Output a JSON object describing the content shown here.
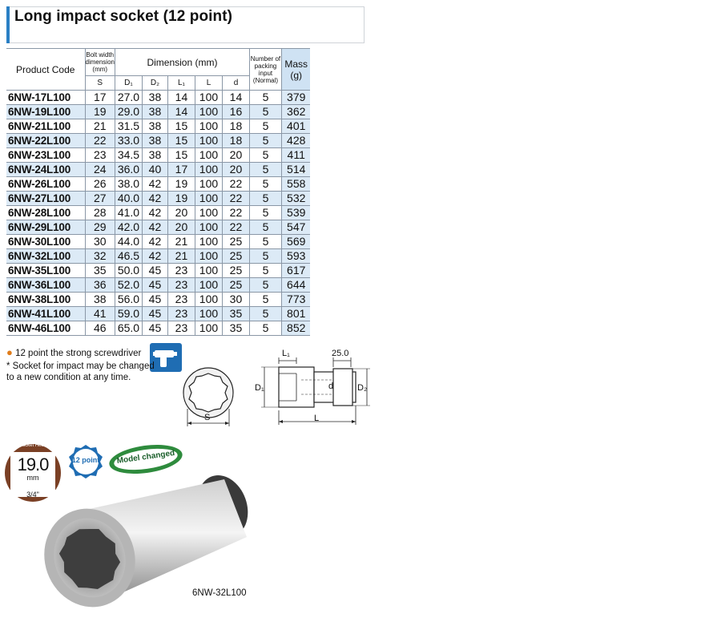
{
  "title": "Long impact socket (12 point)",
  "table": {
    "headers": {
      "product_code": "Product Code",
      "bolt_width": "Bolt width dimension (mm)",
      "dimension": "Dimension (mm)",
      "packing": "Number of packing input (Normal)",
      "mass": "Mass (g)"
    },
    "subheaders": [
      "S",
      "D₁",
      "D₂",
      "L₁",
      "L",
      "d"
    ],
    "rows": [
      {
        "code": "6NW-17L100",
        "s": "17",
        "d1": "27.0",
        "d2": "38",
        "l1": "14",
        "l": "100",
        "d": "14",
        "pack": "5",
        "mass": "379"
      },
      {
        "code": "6NW-19L100",
        "s": "19",
        "d1": "29.0",
        "d2": "38",
        "l1": "14",
        "l": "100",
        "d": "16",
        "pack": "5",
        "mass": "362"
      },
      {
        "code": "6NW-21L100",
        "s": "21",
        "d1": "31.5",
        "d2": "38",
        "l1": "15",
        "l": "100",
        "d": "18",
        "pack": "5",
        "mass": "401"
      },
      {
        "code": "6NW-22L100",
        "s": "22",
        "d1": "33.0",
        "d2": "38",
        "l1": "15",
        "l": "100",
        "d": "18",
        "pack": "5",
        "mass": "428"
      },
      {
        "code": "6NW-23L100",
        "s": "23",
        "d1": "34.5",
        "d2": "38",
        "l1": "15",
        "l": "100",
        "d": "20",
        "pack": "5",
        "mass": "411"
      },
      {
        "code": "6NW-24L100",
        "s": "24",
        "d1": "36.0",
        "d2": "40",
        "l1": "17",
        "l": "100",
        "d": "20",
        "pack": "5",
        "mass": "514"
      },
      {
        "code": "6NW-26L100",
        "s": "26",
        "d1": "38.0",
        "d2": "42",
        "l1": "19",
        "l": "100",
        "d": "22",
        "pack": "5",
        "mass": "558"
      },
      {
        "code": "6NW-27L100",
        "s": "27",
        "d1": "40.0",
        "d2": "42",
        "l1": "19",
        "l": "100",
        "d": "22",
        "pack": "5",
        "mass": "532"
      },
      {
        "code": "6NW-28L100",
        "s": "28",
        "d1": "41.0",
        "d2": "42",
        "l1": "20",
        "l": "100",
        "d": "22",
        "pack": "5",
        "mass": "539"
      },
      {
        "code": "6NW-29L100",
        "s": "29",
        "d1": "42.0",
        "d2": "42",
        "l1": "20",
        "l": "100",
        "d": "22",
        "pack": "5",
        "mass": "547"
      },
      {
        "code": "6NW-30L100",
        "s": "30",
        "d1": "44.0",
        "d2": "42",
        "l1": "21",
        "l": "100",
        "d": "25",
        "pack": "5",
        "mass": "569"
      },
      {
        "code": "6NW-32L100",
        "s": "32",
        "d1": "46.5",
        "d2": "42",
        "l1": "21",
        "l": "100",
        "d": "25",
        "pack": "5",
        "mass": "593"
      },
      {
        "code": "6NW-35L100",
        "s": "35",
        "d1": "50.0",
        "d2": "45",
        "l1": "23",
        "l": "100",
        "d": "25",
        "pack": "5",
        "mass": "617"
      },
      {
        "code": "6NW-36L100",
        "s": "36",
        "d1": "52.0",
        "d2": "45",
        "l1": "23",
        "l": "100",
        "d": "25",
        "pack": "5",
        "mass": "644"
      },
      {
        "code": "6NW-38L100",
        "s": "38",
        "d1": "56.0",
        "d2": "45",
        "l1": "23",
        "l": "100",
        "d": "30",
        "pack": "5",
        "mass": "773"
      },
      {
        "code": "6NW-41L100",
        "s": "41",
        "d1": "59.0",
        "d2": "45",
        "l1": "23",
        "l": "100",
        "d": "35",
        "pack": "5",
        "mass": "801"
      },
      {
        "code": "6NW-46L100",
        "s": "46",
        "d1": "65.0",
        "d2": "45",
        "l1": "23",
        "l": "100",
        "d": "35",
        "pack": "5",
        "mass": "852"
      }
    ]
  },
  "notes": {
    "note1": "12 point the strong screwdriver",
    "note2": "* Socket for impact may be changed to a new condition at any time."
  },
  "diagram": {
    "front_label": "S",
    "side_labels": {
      "l1": "L₁",
      "square": "25.0",
      "d1": "D₁",
      "d": "d",
      "d2": "D₂",
      "l": "L"
    }
  },
  "badges": {
    "socket_head": "Socket Head",
    "size": "19.0",
    "unit": "mm",
    "inch": "3/4\"",
    "point": "12 point",
    "model": "Model changed"
  },
  "photo_caption": "6NW-32L100",
  "colors": {
    "accent": "#2a7fc4",
    "row_alt": "#dceaf6",
    "badge_brown": "#7a4025",
    "badge_blue": "#1f6db3",
    "badge_green": "#2e8b3d"
  },
  "icons": [
    "impact-driver-icon",
    "twelve-point-icon"
  ]
}
